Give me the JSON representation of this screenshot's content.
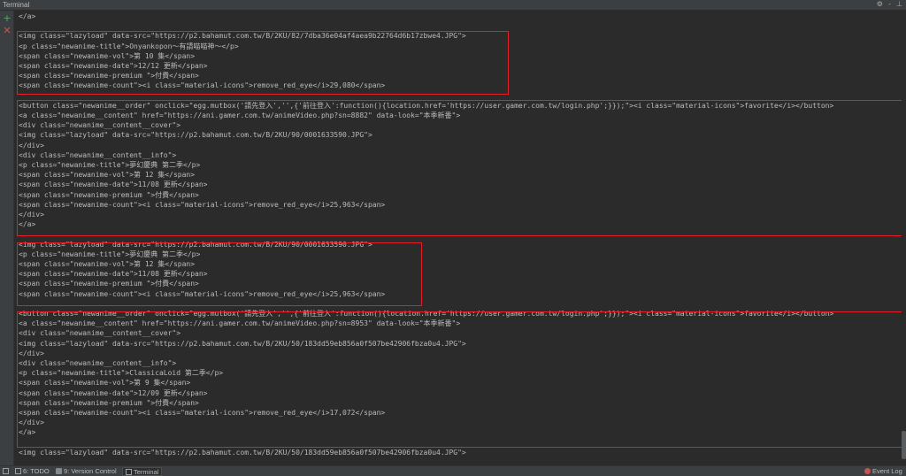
{
  "window": {
    "title": "Terminal",
    "header_icons": [
      "⚙",
      "-",
      "⊥"
    ]
  },
  "toolbar": {
    "add_icon": "+",
    "close_icon": "✕"
  },
  "terminal_lines": [
    "</a>",
    "",
    "<img class=\"lazyload\" data-src=\"https://p2.bahamut.com.tw/B/2KU/82/7dba36e04af4aea9b22764d6b17zbwe4.JPG\">",
    "<p class=\"newanime-title\">Onyankopon～有請喵喵神～</p>",
    "<span class=\"newanime-vol\">第 10 集</span>",
    "<span class=\"newanime-date\">12/12 更新</span>",
    "<span class=\"newanime-premium \">付費</span>",
    "<span class=\"newanime-count\"><i class=\"material-icons\">remove_red_eye</i>29,080</span>",
    "",
    "<button class=\"newanime__order\" onclick=\"egg.mutbox('請先登入','',{'前往登入':function(){location.href='https://user.gamer.com.tw/login.php';}});\"><i class=\"material-icons\">favorite</i></button>",
    "<a class=\"newanime__content\" href=\"https://ani.gamer.com.tw/animeVideo.php?sn=8882\" data-look=\"本季新番\">",
    "<div class=\"newanime__content__cover\">",
    "<img class=\"lazyload\" data-src=\"https://p2.bahamut.com.tw/B/2KU/90/0001633590.JPG\">",
    "</div>",
    "<div class=\"newanime__content__info\">",
    "<p class=\"newanime-title\">夢幻慶典 第二季</p>",
    "<span class=\"newanime-vol\">第 12 集</span>",
    "<span class=\"newanime-date\">11/08 更新</span>",
    "<span class=\"newanime-premium \">付費</span>",
    "<span class=\"newanime-count\"><i class=\"material-icons\">remove_red_eye</i>25,963</span>",
    "</div>",
    "</a>",
    "",
    "<img class=\"lazyload\" data-src=\"https://p2.bahamut.com.tw/B/2KU/90/0001633590.JPG\">",
    "<p class=\"newanime-title\">夢幻慶典 第二季</p>",
    "<span class=\"newanime-vol\">第 12 集</span>",
    "<span class=\"newanime-date\">11/08 更新</span>",
    "<span class=\"newanime-premium \">付費</span>",
    "<span class=\"newanime-count\"><i class=\"material-icons\">remove_red_eye</i>25,963</span>",
    "",
    "<button class=\"newanime__order\" onclick=\"egg.mutbox('請先登入','',{'前往登入':function(){location.href='https://user.gamer.com.tw/login.php';}});\"><i class=\"material-icons\">favorite</i></button>",
    "<a class=\"newanime__content\" href=\"https://ani.gamer.com.tw/animeVideo.php?sn=8953\" data-look=\"本季新番\">",
    "<div class=\"newanime__content__cover\">",
    "<img class=\"lazyload\" data-src=\"https://p2.bahamut.com.tw/B/2KU/50/183dd59eb856a0f507be42906fbza0u4.JPG\">",
    "</div>",
    "<div class=\"newanime__content__info\">",
    "<p class=\"newanime-title\">ClassicaLoid 第二季</p>",
    "<span class=\"newanime-vol\">第 9 集</span>",
    "<span class=\"newanime-date\">12/09 更新</span>",
    "<span class=\"newanime-premium \">付費</span>",
    "<span class=\"newanime-count\"><i class=\"material-icons\">remove_red_eye</i>17,072</span>",
    "</div>",
    "</a>",
    "",
    "<img class=\"lazyload\" data-src=\"https://p2.bahamut.com.tw/B/2KU/50/183dd59eb856a0f507be42906fbza0u4.JPG\">"
  ],
  "statusbar": {
    "tabs": [
      {
        "label": "6: TODO",
        "icon": "todo-icon"
      },
      {
        "label": "9: Version Control",
        "icon": "version-control-icon"
      },
      {
        "label": "Terminal",
        "icon": "terminal-icon",
        "active": true
      }
    ],
    "event_log": {
      "label": "Event Log",
      "badge": "1"
    }
  },
  "colors": {
    "background": "#2b2b2b",
    "text": "#bbbbbb",
    "highlight_border": "#e3202a",
    "toolbar_add": "#59a869",
    "toolbar_close": "#c75450"
  }
}
